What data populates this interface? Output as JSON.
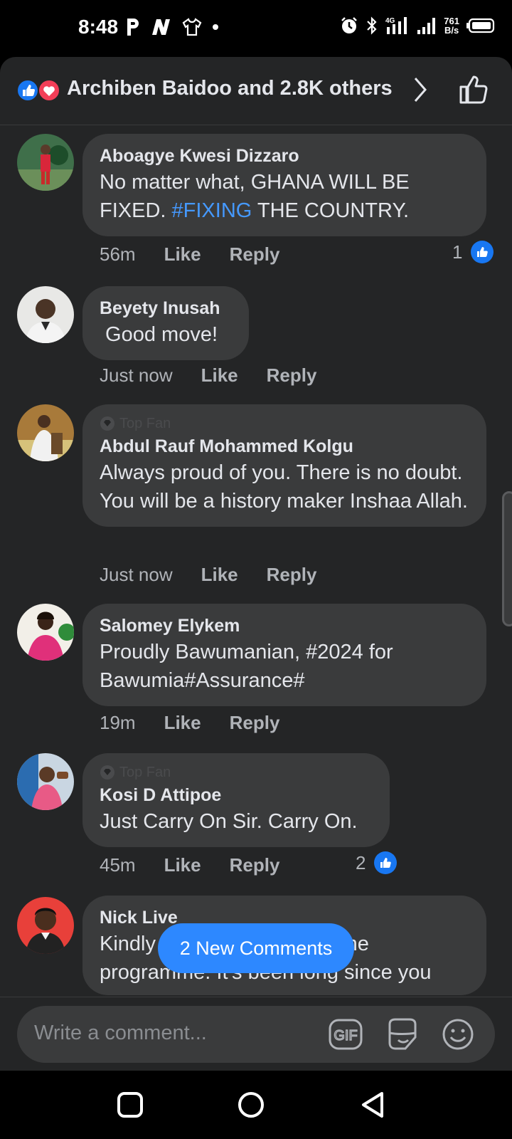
{
  "status_bar": {
    "time": "8:48",
    "net_speed_value": "761",
    "net_speed_unit": "B/s",
    "icons": [
      "p-app-icon",
      "n-app-icon",
      "shirt-icon",
      "dot-icon",
      "alarm-icon",
      "bluetooth-icon",
      "4g-signal-icon",
      "signal-icon",
      "battery-icon"
    ]
  },
  "reactions": {
    "summary": "Archiben Baidoo and 2.8K others",
    "icons": [
      "like-reaction-icon",
      "love-reaction-icon"
    ]
  },
  "comments": [
    {
      "author": "Aboagye Kwesi Dizzaro",
      "text_before": "No matter what, GHANA WILL BE FIXED.  ",
      "hashtag": "#FIXING",
      "text_after": " THE COUNTRY.",
      "time": "56m",
      "like_label": "Like",
      "reply_label": "Reply",
      "like_count": "1"
    },
    {
      "author": "Beyety Inusah",
      "text": " Good move!",
      "time": "Just now",
      "like_label": "Like",
      "reply_label": "Reply"
    },
    {
      "badge": "Top Fan",
      "author": "Abdul Rauf Mohammed Kolgu",
      "text": "Always proud of you. There is no doubt. You will be a history maker Inshaa Allah.",
      "time": "Just now",
      "like_label": "Like",
      "reply_label": "Reply"
    },
    {
      "author": "Salomey Elykem",
      "text": "Proudly  Bawumanian, #2024 for Bawumia#Assurance#",
      "time": "19m",
      "like_label": "Like",
      "reply_label": "Reply"
    },
    {
      "badge": "Top Fan",
      "author": "Kosi D Attipoe",
      "text": "Just Carry On Sir. Carry On.",
      "time": "45m",
      "like_label": "Like",
      "reply_label": "Reply",
      "like_count": "2"
    },
    {
      "author": "Nick Live",
      "text": "Kindly send me the link of the programme. It's been long since you"
    }
  ],
  "new_comments_pill": "2 New Comments",
  "composer": {
    "placeholder": "Write a comment...",
    "gif_label": "GIF",
    "icons": [
      "gif-icon",
      "sticker-icon",
      "emoji-icon"
    ]
  },
  "nav": [
    "recent-apps-icon",
    "home-icon",
    "back-icon"
  ],
  "colors": {
    "background": "#242526",
    "bubble": "#3a3b3c",
    "accent": "#2d88ff",
    "hashtag": "#4599ff"
  }
}
